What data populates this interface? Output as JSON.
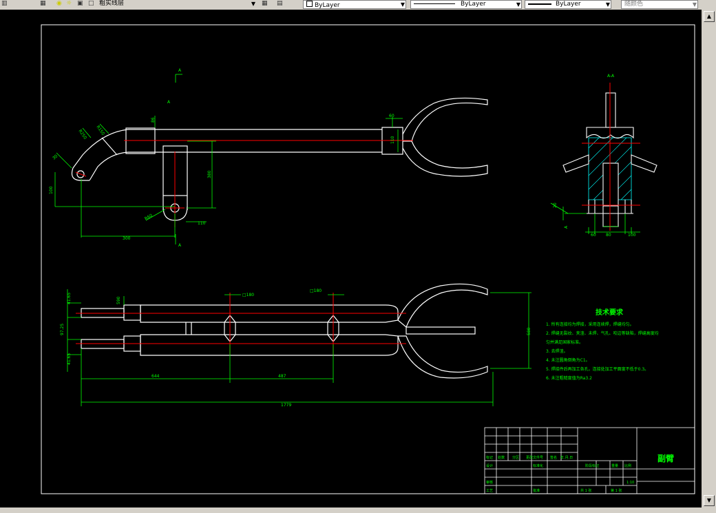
{
  "toolbar": {
    "layer_name": "粗实线层",
    "color_control": "ByLayer",
    "linetype_control": "ByLayer",
    "lineweight_control": "ByLayer",
    "plotstyle_control": "随颜色"
  },
  "drawing": {
    "title": "副臂",
    "section_label": "A-A",
    "section_marker": "A",
    "notes_title": "技术要求",
    "notes": [
      "1. 所有连接均为焊接，采用连续焊，焊缝均匀。",
      "2. 焊缝无裂纹、夹渣、未焊、气孔、咬边等缺陷，焊缝高度均",
      "   匀并满足国家标准。",
      "3. 去焊渣。",
      "4. 未注圆角倒角为C1。",
      "5. 焊接件后再加工各孔，连接处加工平面度不低于0.3。",
      "6. 未注粗糙度值为Ra3.2"
    ],
    "dimensions": {
      "d_590": "590",
      "d_110": "110",
      "d_100": "100",
      "d_380": "380",
      "d_110b": "110",
      "d_300": "300",
      "d_1779": "1779",
      "d_644": "644",
      "d_487": "487",
      "d_580": "580",
      "d_41_65": "41.65",
      "d_97_25": "97.25",
      "d_41_65b": "41.65",
      "d_180a": "□180",
      "d_180b": "□180",
      "d_60": "60",
      "d_60b": "60",
      "d_20": "20",
      "d_86": "86",
      "d_80": "80",
      "d_100b": "100",
      "d_r2": "R250",
      "d_r3": "R150",
      "d_r4": "R60",
      "d_30": "30"
    },
    "title_block": {
      "row_labels": [
        "标记",
        "处数",
        "分区",
        "更改文件号",
        "签名",
        "年.月.日"
      ],
      "design": "设计",
      "standardize": "标准化",
      "stage_mark": "阶段标记",
      "weight": "重量",
      "scale": "比例",
      "scale_value": "1:10",
      "review": "审核",
      "process": "工艺",
      "approve": "批准",
      "total_sheets": "共 1 张",
      "sheet_no": "第 1 张"
    }
  },
  "colors": {
    "canvas": "#000000",
    "geometry": "#ffffff",
    "dimension": "#00ff00",
    "centerline": "#ff0000",
    "hatch": "#00ffff",
    "toolbar": "#d4d0c8"
  },
  "icons": [
    "layers-icon",
    "lightbulb-icon",
    "sun-icon",
    "lock-icon",
    "color-square-icon",
    "layer-prev-icon",
    "chevron-down-icon",
    "scroll-up-icon",
    "scroll-down-icon"
  ]
}
